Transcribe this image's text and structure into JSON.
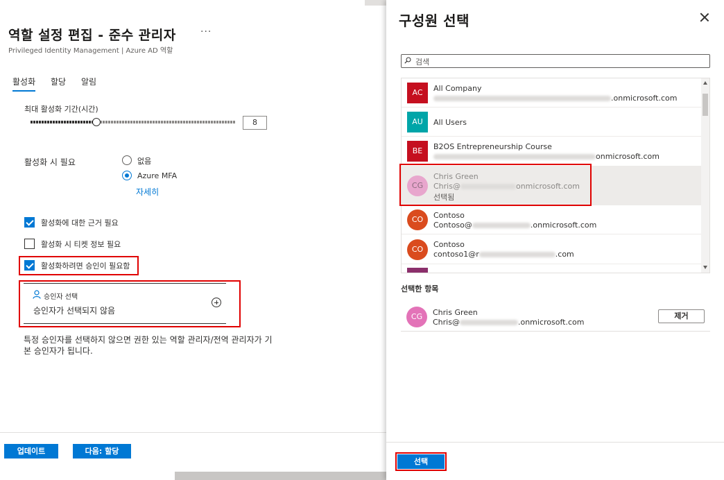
{
  "left": {
    "title": "역할 설정 편집 - 준수 관리자",
    "more": "···",
    "subtitle": "Privileged Identity Management | Azure AD 역할",
    "tabs": [
      {
        "label": "활성화",
        "active": true
      },
      {
        "label": "할당",
        "active": false
      },
      {
        "label": "알림",
        "active": false
      }
    ],
    "max_duration_label": "최대 활성화 기간(시간)",
    "max_duration_value": 8,
    "max_duration_max": 24,
    "require_label": "활성화 시 필요",
    "require_options": [
      {
        "label": "없음",
        "checked": false
      },
      {
        "label": "Azure MFA",
        "checked": true
      }
    ],
    "details_link": "자세히",
    "checkboxes": [
      {
        "label": "활성화에 대한 근거 필요",
        "checked": true
      },
      {
        "label": "활성화 시 티켓 정보 필요",
        "checked": false
      },
      {
        "label": "활성화하려면 승인이 필요함",
        "checked": true
      }
    ],
    "approver": {
      "label": "승인자 선택",
      "value": "승인자가 선택되지 않음"
    },
    "note": "특정 승인자를 선택하지 않으면 권한 있는 역할 관리자/전역 관리자가 기본 승인자가 됩니다.",
    "buttons": {
      "update": "업데이트",
      "next": "다음: 할당"
    }
  },
  "panel": {
    "title": "구성원 선택",
    "search_placeholder": "검색",
    "members": [
      {
        "initials": "AC",
        "name": "All Company",
        "email_suffix": ".onmicrosoft.com",
        "color": "#c50f1f",
        "round": false
      },
      {
        "initials": "AU",
        "name": "All Users",
        "color": "#00a5a8",
        "round": false
      },
      {
        "initials": "BE",
        "name": "B2OS Entrepreneurship Course",
        "email_suffix": "onmicrosoft.com",
        "color": "#c50f1f",
        "round": false
      },
      {
        "initials": "CG",
        "name": "Chris Green",
        "email_prefix": "Chris@",
        "email_suffix": "onmicrosoft.com",
        "status": "선택됨",
        "color": "#e8a6cd",
        "round": true,
        "selected": true
      },
      {
        "initials": "CO",
        "name": "Contoso",
        "email_prefix": "Contoso@",
        "email_suffix": ".onmicrosoft.com",
        "color": "#da4b1e",
        "round": true
      },
      {
        "initials": "CO",
        "name": "Contoso",
        "email_prefix": "contoso1@r",
        "email_suffix": ".com",
        "color": "#da4b1e",
        "round": true
      }
    ],
    "selected_heading": "선택한 항목",
    "selected_item": {
      "initials": "CG",
      "name": "Chris Green",
      "email_prefix": "Chris@",
      "email_suffix": ".onmicrosoft.com",
      "color": "#e373b8"
    },
    "remove_button": "제거",
    "select_button": "선택"
  }
}
